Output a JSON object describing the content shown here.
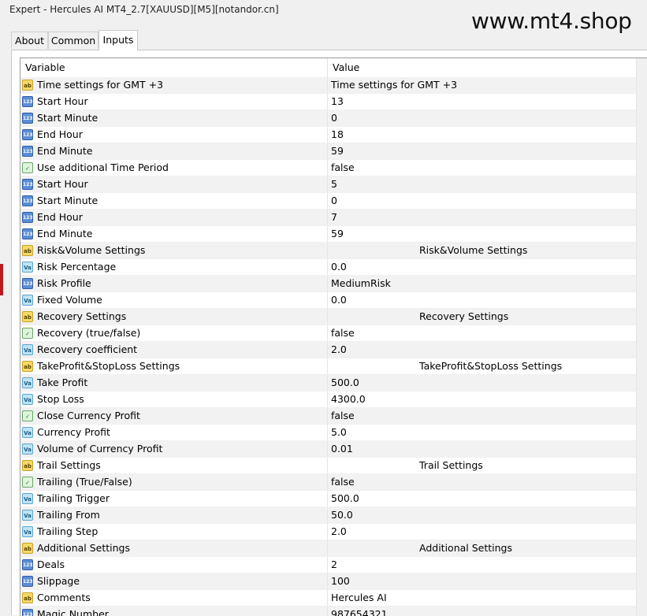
{
  "window": {
    "title": "Expert - Hercules AI MT4_2.7[XAUUSD][M5][notandor.cn]"
  },
  "watermark": "www.mt4.shop",
  "tabs": [
    {
      "label": "About"
    },
    {
      "label": "Common"
    },
    {
      "label": "Inputs"
    }
  ],
  "table": {
    "headers": {
      "variable": "Variable",
      "value": "Value"
    },
    "rows": [
      {
        "icon": "ab",
        "variable": "Time settings for GMT +3",
        "value": "Time settings for GMT +3"
      },
      {
        "icon": "123",
        "variable": "Start Hour",
        "value": "13"
      },
      {
        "icon": "123",
        "variable": "Start Minute",
        "value": "0"
      },
      {
        "icon": "123",
        "variable": "End Hour",
        "value": "18"
      },
      {
        "icon": "123",
        "variable": "End Minute",
        "value": "59"
      },
      {
        "icon": "bool",
        "variable": "Use additional Time Period",
        "value": "false"
      },
      {
        "icon": "123",
        "variable": "Start Hour",
        "value": "5"
      },
      {
        "icon": "123",
        "variable": "Start Minute",
        "value": "0"
      },
      {
        "icon": "123",
        "variable": "End Hour",
        "value": "7"
      },
      {
        "icon": "123",
        "variable": "End Minute",
        "value": "59"
      },
      {
        "icon": "ab",
        "variable": "Risk&Volume Settings",
        "value": "Risk&Volume Settings",
        "centered": true
      },
      {
        "icon": "val",
        "variable": "Risk Percentage",
        "value": "0.0"
      },
      {
        "icon": "123",
        "variable": "Risk Profile",
        "value": "MediumRisk"
      },
      {
        "icon": "val",
        "variable": "Fixed Volume",
        "value": "0.0"
      },
      {
        "icon": "ab",
        "variable": "Recovery Settings",
        "value": "Recovery Settings",
        "centered": true
      },
      {
        "icon": "bool",
        "variable": "Recovery (true/false)",
        "value": "false"
      },
      {
        "icon": "val",
        "variable": "Recovery coefficient",
        "value": "2.0"
      },
      {
        "icon": "ab",
        "variable": "TakeProfit&StopLoss Settings",
        "value": "TakeProfit&StopLoss Settings",
        "centered": true
      },
      {
        "icon": "val",
        "variable": "Take Profit",
        "value": "500.0"
      },
      {
        "icon": "val",
        "variable": "Stop Loss",
        "value": "4300.0"
      },
      {
        "icon": "bool",
        "variable": "Close Currency Profit",
        "value": "false"
      },
      {
        "icon": "val",
        "variable": "Currency Profit",
        "value": "5.0"
      },
      {
        "icon": "val",
        "variable": "Volume of Currency Profit",
        "value": "0.01"
      },
      {
        "icon": "ab",
        "variable": "Trail Settings",
        "value": "Trail Settings",
        "centered": true
      },
      {
        "icon": "bool",
        "variable": "Trailing (True/False)",
        "value": "false"
      },
      {
        "icon": "val",
        "variable": "Trailing Trigger",
        "value": "500.0"
      },
      {
        "icon": "val",
        "variable": "Trailing From",
        "value": "50.0"
      },
      {
        "icon": "val",
        "variable": "Trailing Step",
        "value": "2.0"
      },
      {
        "icon": "ab",
        "variable": "Additional Settings",
        "value": "Additional Settings",
        "centered": true
      },
      {
        "icon": "123",
        "variable": "Deals",
        "value": "2"
      },
      {
        "icon": "123",
        "variable": "Slippage",
        "value": "100"
      },
      {
        "icon": "ab",
        "variable": "Comments",
        "value": "Hercules AI"
      },
      {
        "icon": "123",
        "variable": "Magic Number",
        "value": "987654321"
      }
    ]
  },
  "icon_glyphs": {
    "ab": "ab",
    "123": "123",
    "bool": "✓",
    "val": "Va"
  },
  "icon_names": {
    "ab": "string-type-icon",
    "123": "integer-type-icon",
    "bool": "boolean-type-icon",
    "val": "double-type-icon"
  }
}
